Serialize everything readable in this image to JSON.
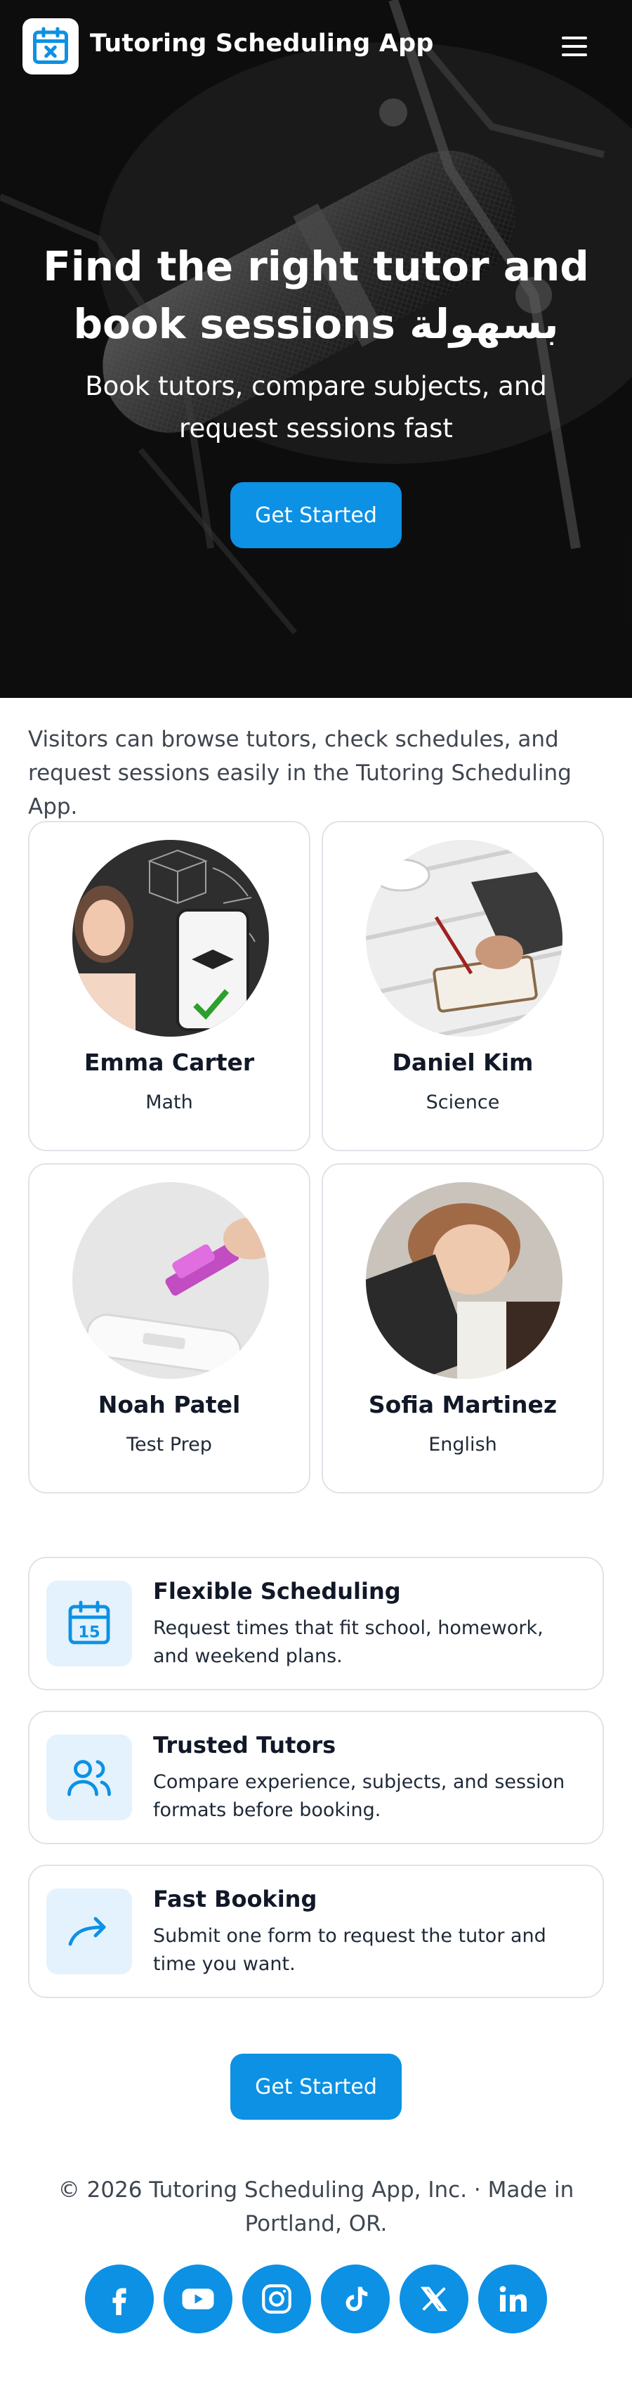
{
  "header": {
    "app_title": "Tutoring Scheduling App",
    "logo_icon": "calendar-x-icon",
    "menu_icon": "hamburger-menu-icon"
  },
  "hero": {
    "heading": "Find the right tutor and book sessions بسهولة",
    "subheading": "Book tutors, compare subjects, and request sessions fast",
    "cta_label": "Get Started",
    "image": "microphone-studio-photo"
  },
  "intro": {
    "text": "Visitors can browse tutors, check schedules, and request sessions easily in the Tutoring Scheduling App."
  },
  "tutors": [
    {
      "name": "Emma Carter",
      "subject": "Math",
      "image": "woman-chalkboard-phone-photo"
    },
    {
      "name": "Daniel Kim",
      "subject": "Science",
      "image": "hand-writing-notebook-photo"
    },
    {
      "name": "Noah Patel",
      "subject": "Test Prep",
      "image": "marker-pen-test-photo"
    },
    {
      "name": "Sofia Martinez",
      "subject": "English",
      "image": "child-reading-book-photo"
    }
  ],
  "features": [
    {
      "title": "Flexible Scheduling",
      "description": "Request times that fit school, homework, and weekend plans.",
      "icon": "calendar-15-icon",
      "icon_text": "15"
    },
    {
      "title": "Trusted Tutors",
      "description": "Compare experience, subjects, and session formats before booking.",
      "icon": "users-icon"
    },
    {
      "title": "Fast Booking",
      "description": "Submit one form to request the tutor and time you want.",
      "icon": "arrow-right-icon"
    }
  ],
  "bottom_cta": {
    "label": "Get Started"
  },
  "footer": {
    "text": "© 2026 Tutoring Scheduling App, Inc. · Made in Portland, OR.",
    "socials": [
      "facebook-icon",
      "youtube-icon",
      "instagram-icon",
      "tiktok-icon",
      "x-icon",
      "linkedin-icon"
    ]
  },
  "colors": {
    "accent": "#0c91e4",
    "feature_icon_bg": "#e3f2fc",
    "card_border": "#dfe3e8"
  }
}
